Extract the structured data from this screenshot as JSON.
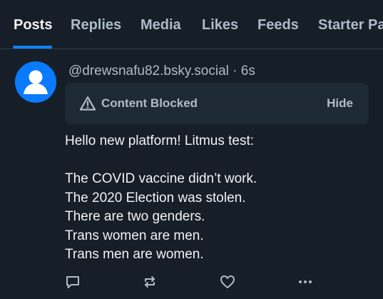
{
  "tabs": [
    {
      "label": "Posts",
      "active": true
    },
    {
      "label": "Replies",
      "active": false
    },
    {
      "label": "Media",
      "active": false
    },
    {
      "label": "Likes",
      "active": false
    },
    {
      "label": "Feeds",
      "active": false
    },
    {
      "label": "Starter Pa",
      "active": false
    }
  ],
  "post": {
    "handle": "@drewsnafu82.bsky.social",
    "time": "· 6s",
    "warning": {
      "label": "Content Blocked",
      "action": "Hide"
    },
    "text_lines": [
      "Hello new platform! Litmus test:",
      "",
      "The COVID vaccine didn’t work.",
      "The 2020 Election was stolen.",
      "There are two genders.",
      "Trans women are men.",
      "Trans men are women."
    ],
    "actions": [
      "reply-icon",
      "repost-icon",
      "like-icon",
      "more-options-icon"
    ]
  },
  "colors": {
    "background": "#161e27",
    "accent": "#1083fe",
    "muted_text": "#aebbc9",
    "warning_box": "#1e2936",
    "avatar": "#0a7aff"
  }
}
